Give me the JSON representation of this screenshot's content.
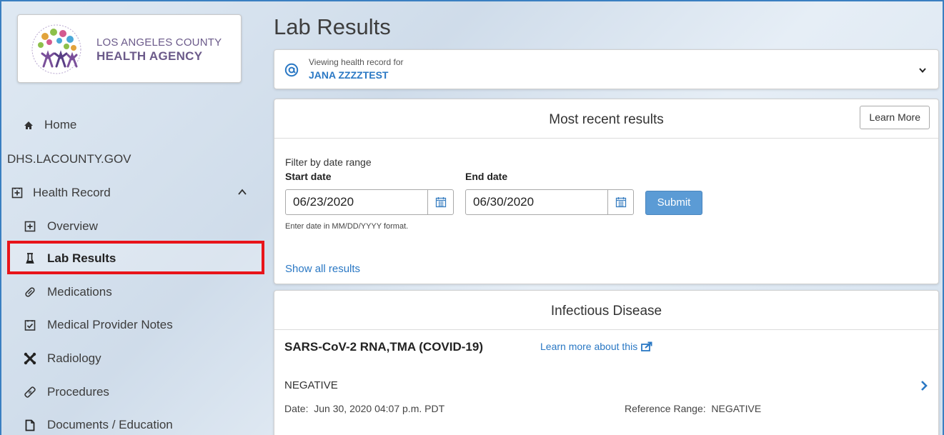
{
  "org": {
    "logo_line1": "LOS ANGELES COUNTY",
    "logo_line2": "HEALTH AGENCY",
    "logo_icon": "people-tree-logo"
  },
  "sidebar": {
    "items": [
      {
        "label": "Home",
        "icon": "home-icon"
      },
      {
        "label": "DHS.LACOUNTY.GOV",
        "icon": ""
      },
      {
        "label": "Health Record",
        "icon": "health-record-icon"
      },
      {
        "label": "Overview",
        "icon": "overview-icon"
      },
      {
        "label": "Lab Results",
        "icon": "flask-icon"
      },
      {
        "label": "Medications",
        "icon": "pill-icon"
      },
      {
        "label": "Medical Provider Notes",
        "icon": "clipboard-check-icon"
      },
      {
        "label": "Radiology",
        "icon": "bone-icon"
      },
      {
        "label": "Procedures",
        "icon": "bandage-icon"
      },
      {
        "label": "Documents / Education",
        "icon": "document-icon"
      }
    ]
  },
  "page": {
    "title": "Lab Results"
  },
  "patient": {
    "viewing_label": "Viewing health record for",
    "name": "JANA ZZZZTEST"
  },
  "results": {
    "title": "Most recent results",
    "learn_more": "Learn More",
    "filter_label": "Filter by date range",
    "start_label": "Start date",
    "end_label": "End date",
    "start_value": "06/23/2020",
    "end_value": "06/30/2020",
    "submit": "Submit",
    "hint": "Enter date in MM/DD/YYYY format.",
    "show_all": "Show all results"
  },
  "infectious": {
    "title": "Infectious Disease",
    "test_name": "SARS-CoV-2 RNA,TMA (COVID-19)",
    "learn_link": "Learn more about this",
    "result": "NEGATIVE",
    "date_label": "Date:",
    "date_value": "Jun 30, 2020 04:07 p.m. PDT",
    "ref_label": "Reference Range:",
    "ref_value": "NEGATIVE"
  },
  "colors": {
    "accent": "#2a78c4",
    "submit_bg": "#5b9bd5",
    "highlight": "#e8141a",
    "logo_text": "#6b5a8a"
  }
}
